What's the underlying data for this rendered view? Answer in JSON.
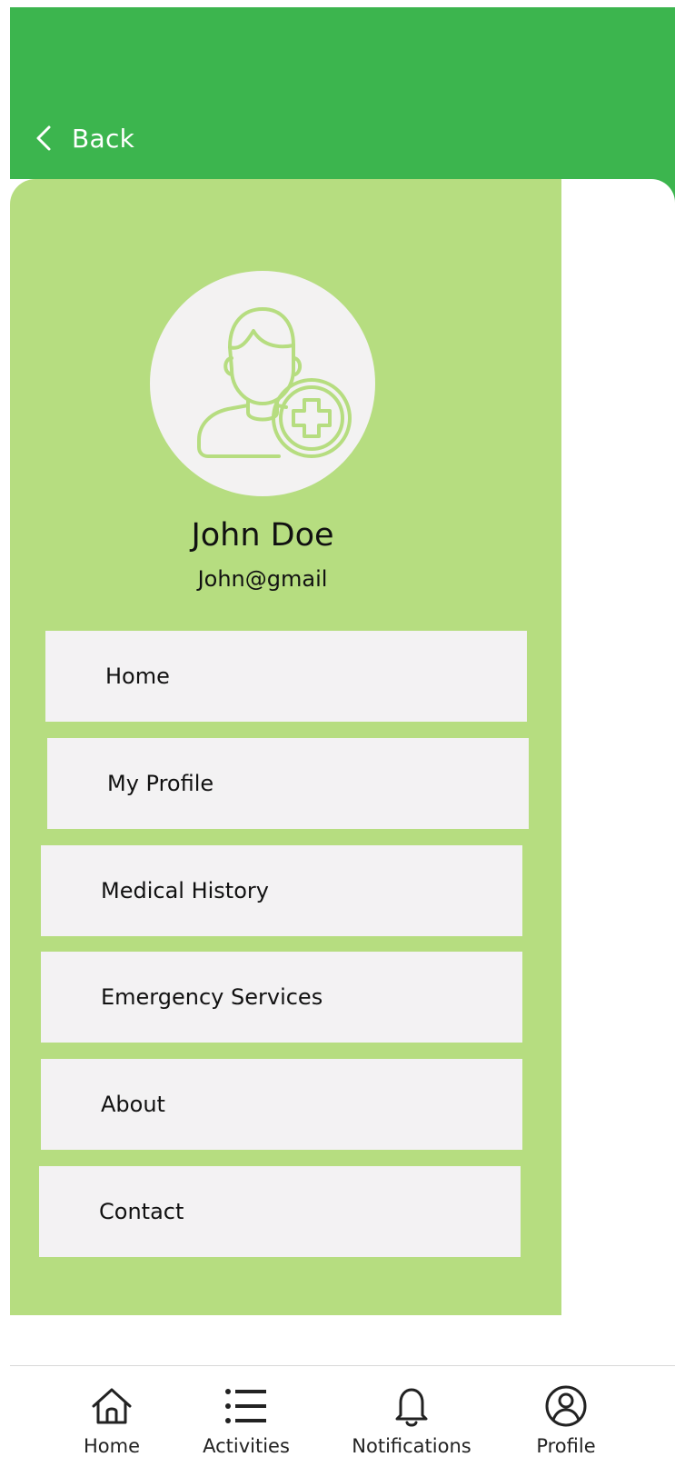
{
  "header": {
    "back_label": "Back",
    "color": "#3cb54e"
  },
  "drawer": {
    "background_color": "#b6dd80",
    "user": {
      "name": "John Doe",
      "email": "John@gmail",
      "avatar_icon": "user-add-medical-icon"
    },
    "menu": [
      {
        "label": "Home"
      },
      {
        "label": "My Profile"
      },
      {
        "label": "Medical History"
      },
      {
        "label": "Emergency Services"
      },
      {
        "label": "About"
      },
      {
        "label": "Contact"
      }
    ]
  },
  "bottom_nav": {
    "items": [
      {
        "label": "Home",
        "icon": "home-icon"
      },
      {
        "label": "Activities",
        "icon": "list-icon"
      },
      {
        "label": "Notifications",
        "icon": "bell-icon"
      },
      {
        "label": "Profile",
        "icon": "user-circle-icon"
      }
    ]
  }
}
